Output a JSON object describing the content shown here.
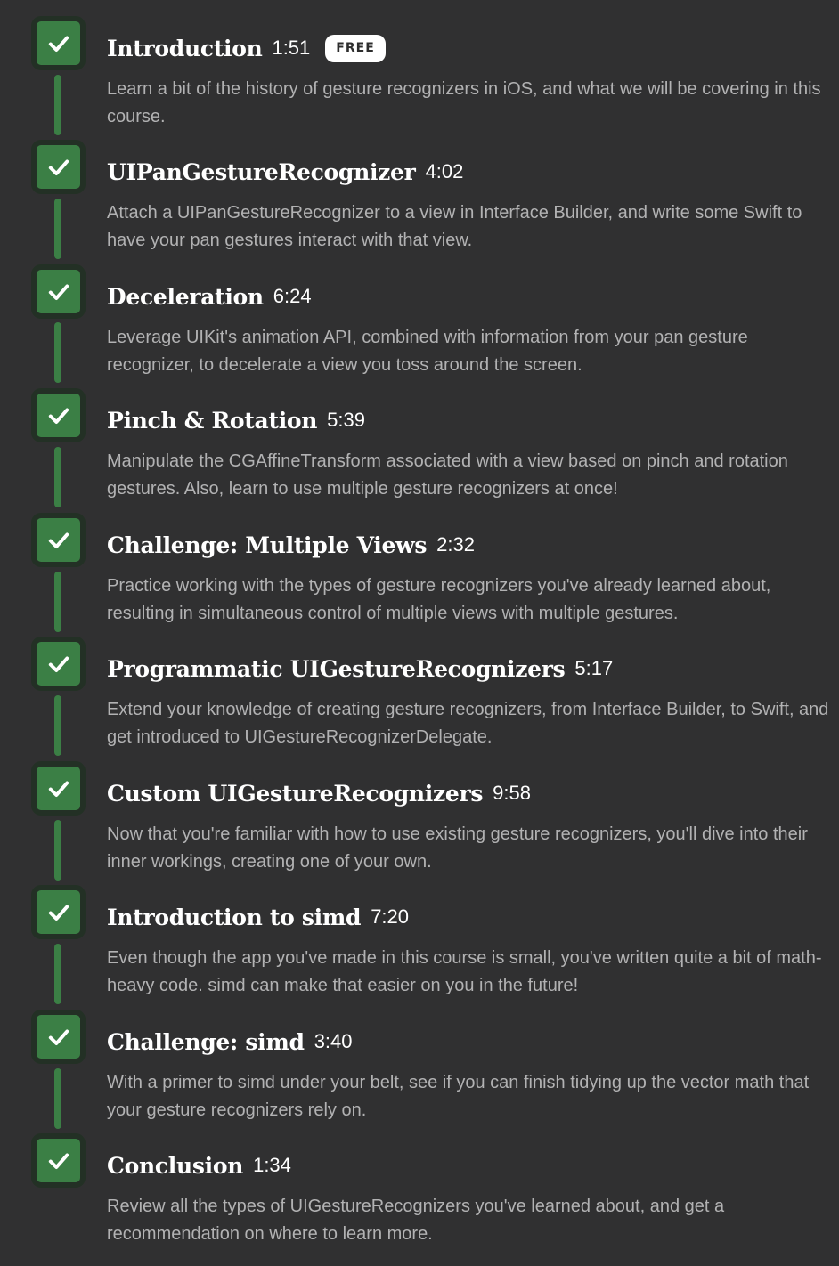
{
  "colors": {
    "background": "#303031",
    "check_fill": "#3b7f45",
    "check_border": "#233025",
    "title": "#ffffff",
    "description": "#b2b2b3"
  },
  "episodes": [
    {
      "title": "Introduction",
      "duration": "1:51",
      "badge": "FREE",
      "description": "Learn a bit of the history of gesture recognizers in iOS, and what we will be covering in this course.",
      "completed": true,
      "icon": "checkmark-icon"
    },
    {
      "title": "UIPanGestureRecognizer",
      "duration": "4:02",
      "description": "Attach a UIPanGestureRecognizer to a view in Interface Builder, and write some Swift to have your pan gestures interact with that view.",
      "completed": true,
      "icon": "checkmark-icon"
    },
    {
      "title": "Deceleration",
      "duration": "6:24",
      "description": "Leverage UIKit's animation API, combined with information from your pan gesture recognizer, to decelerate a view you toss around the screen.",
      "completed": true,
      "icon": "checkmark-icon"
    },
    {
      "title": "Pinch & Rotation",
      "duration": "5:39",
      "description": "Manipulate the CGAffineTransform associated with a view based on pinch and rotation gestures. Also, learn to use multiple gesture recognizers at once!",
      "completed": true,
      "icon": "checkmark-icon"
    },
    {
      "title": "Challenge: Multiple Views",
      "duration": "2:32",
      "description": "Practice working with the types of gesture recognizers you've already learned about, resulting in simultaneous control of multiple views with multiple gestures.",
      "completed": true,
      "icon": "checkmark-icon"
    },
    {
      "title": "Programmatic UIGestureRecognizers",
      "duration": "5:17",
      "description": "Extend your knowledge of creating gesture recognizers, from Interface Builder, to Swift, and get introduced to UIGestureRecognizerDelegate.",
      "completed": true,
      "icon": "checkmark-icon"
    },
    {
      "title": "Custom UIGestureRecognizers",
      "duration": "9:58",
      "description": "Now that you're familiar with how to use existing gesture recognizers, you'll dive into their inner workings, creating one of your own.",
      "completed": true,
      "icon": "checkmark-icon"
    },
    {
      "title": "Introduction to simd",
      "duration": "7:20",
      "description": "Even though the app you've made in this course is small, you've written quite a bit of math-heavy code. simd can make that easier on you in the future!",
      "completed": true,
      "icon": "checkmark-icon"
    },
    {
      "title": "Challenge: simd",
      "duration": "3:40",
      "description": "With a primer to simd under your belt, see if you can finish tidying up the vector math that your gesture recognizers rely on.",
      "completed": true,
      "icon": "checkmark-icon"
    },
    {
      "title": "Conclusion",
      "duration": "1:34",
      "description": "Review all the types of UIGestureRecognizers you've learned about, and get a recommendation on where to learn more.",
      "completed": true,
      "icon": "checkmark-icon"
    }
  ]
}
